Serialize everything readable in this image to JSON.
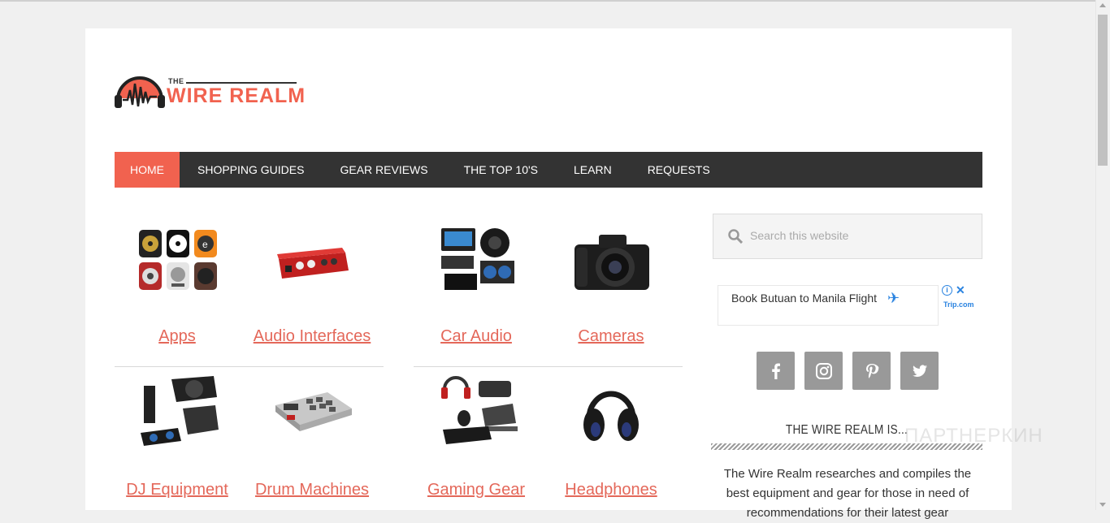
{
  "site": {
    "logo_the": "THE",
    "logo_name": "WIRE REALM"
  },
  "nav": {
    "items": [
      {
        "label": "HOME",
        "active": true
      },
      {
        "label": "SHOPPING GUIDES"
      },
      {
        "label": "GEAR REVIEWS"
      },
      {
        "label": "THE TOP 10'S"
      },
      {
        "label": "LEARN"
      },
      {
        "label": "REQUESTS"
      }
    ]
  },
  "categories": [
    {
      "label": "Apps"
    },
    {
      "label": "Audio Interfaces"
    },
    {
      "label": "Car Audio"
    },
    {
      "label": "Cameras"
    },
    {
      "label": "DJ Equipment"
    },
    {
      "label": "Drum Machines"
    },
    {
      "label": "Gaming Gear"
    },
    {
      "label": "Headphones"
    }
  ],
  "search": {
    "placeholder": "Search this website"
  },
  "ad": {
    "text": "Book Butuan to Manila Flight",
    "brand": "Trip.com",
    "info": "i",
    "close": "✕"
  },
  "social": [
    "facebook-icon",
    "instagram-icon",
    "pinterest-icon",
    "twitter-icon"
  ],
  "widget": {
    "title": "THE WIRE REALM IS...",
    "text": "The Wire Realm researches and compiles the best equipment and gear for those in need of recommendations for their latest gear"
  },
  "watermark": "ПАРТНЕРКИН",
  "colors": {
    "accent": "#f1624f",
    "nav_bg": "#333333",
    "link": "#e4685a",
    "social_bg": "#999999"
  }
}
